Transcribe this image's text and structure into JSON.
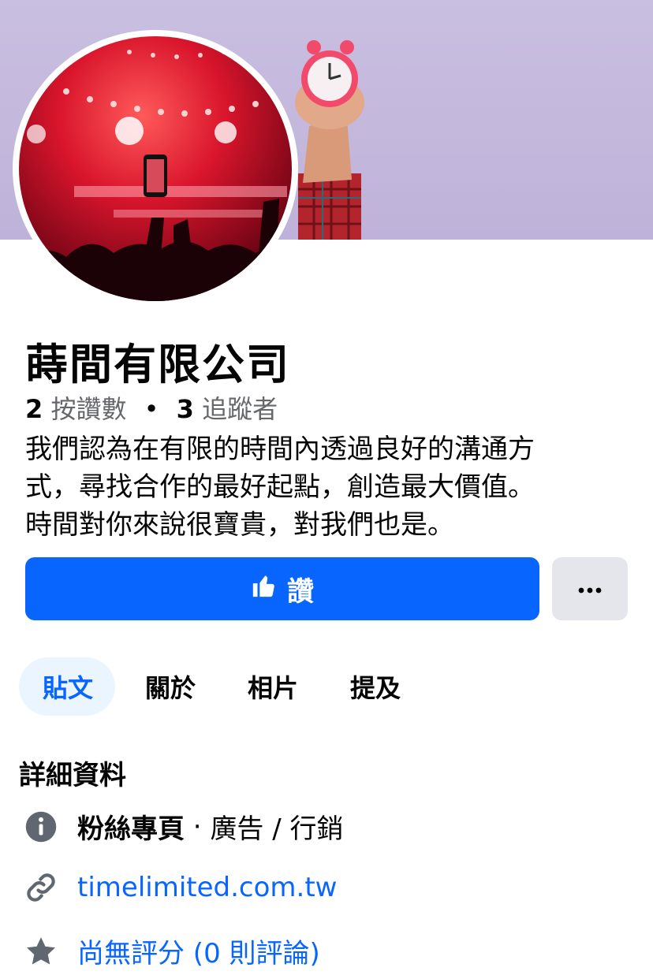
{
  "page": {
    "name": "蒔間有限公司",
    "stats": {
      "likes_count": "2",
      "likes_label": "按讚數",
      "separator": "•",
      "followers_count": "3",
      "followers_label": "追蹤者"
    },
    "bio_lines": [
      "我們認為在有限的時間內透過良好的溝通方",
      "式，尋找合作的最好起點，創造最大價值。",
      "時間對你來說很寶貴，對我們也是。"
    ]
  },
  "actions": {
    "like_label": "讚",
    "more_label": "•••"
  },
  "tabs": [
    {
      "label": "貼文",
      "active": true
    },
    {
      "label": "關於",
      "active": false
    },
    {
      "label": "相片",
      "active": false
    },
    {
      "label": "提及",
      "active": false
    }
  ],
  "details": {
    "title": "詳細資料",
    "category_type": "粉絲專頁",
    "category_sep": " · ",
    "category_value": "廣告 / 行銷",
    "website": "timelimited.com.tw",
    "rating": "尚無評分 (0 則評論)"
  },
  "colors": {
    "accent": "#0866ff",
    "secondary_button": "#e4e6eb",
    "active_tab_bg": "#ebf5ff",
    "muted_text": "#65676b"
  },
  "icons": [
    "like-thumb-icon",
    "more-dots-icon",
    "info-icon",
    "link-icon",
    "star-icon"
  ]
}
